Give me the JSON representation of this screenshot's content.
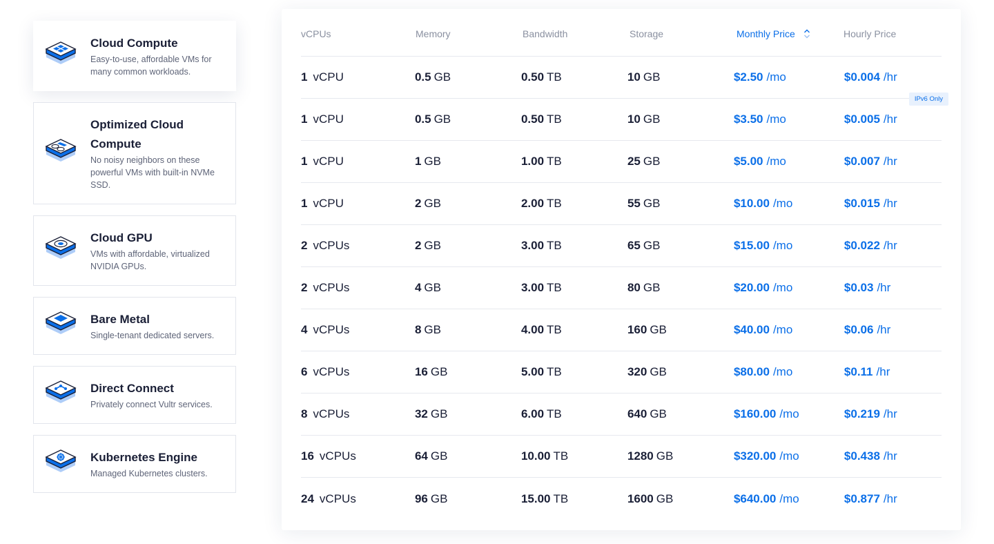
{
  "products": [
    {
      "id": "cloud-compute",
      "title": "Cloud Compute",
      "desc": "Easy-to-use, affordable VMs for many common workloads.",
      "active": true
    },
    {
      "id": "optimized-cloud-compute",
      "title": "Optimized Cloud Compute",
      "desc": "No noisy neighbors on these powerful VMs with built-in NVMe SSD.",
      "active": false
    },
    {
      "id": "cloud-gpu",
      "title": "Cloud GPU",
      "desc": "VMs with affordable, virtualized NVIDIA GPUs.",
      "active": false
    },
    {
      "id": "bare-metal",
      "title": "Bare Metal",
      "desc": "Single-tenant dedicated servers.",
      "active": false
    },
    {
      "id": "direct-connect",
      "title": "Direct Connect",
      "desc": "Privately connect Vultr services.",
      "active": false
    },
    {
      "id": "kubernetes-engine",
      "title": "Kubernetes Engine",
      "desc": "Managed Kubernetes clusters.",
      "active": false
    }
  ],
  "table": {
    "headers": {
      "vcpus": "vCPUs",
      "memory": "Memory",
      "bandwidth": "Bandwidth",
      "storage": "Storage",
      "monthly": "Monthly Price",
      "hourly": "Hourly Price"
    },
    "rows": [
      {
        "vcpu": "1",
        "vcpu_unit": "vCPU",
        "mem": "0.5",
        "mem_unit": "GB",
        "bw": "0.50",
        "bw_unit": "TB",
        "sto": "10",
        "sto_unit": "GB",
        "mo": "$2.50",
        "mo_unit": "/mo",
        "hr": "$0.004",
        "hr_unit": "/hr",
        "badge": "IPv6 Only"
      },
      {
        "vcpu": "1",
        "vcpu_unit": "vCPU",
        "mem": "0.5",
        "mem_unit": "GB",
        "bw": "0.50",
        "bw_unit": "TB",
        "sto": "10",
        "sto_unit": "GB",
        "mo": "$3.50",
        "mo_unit": "/mo",
        "hr": "$0.005",
        "hr_unit": "/hr"
      },
      {
        "vcpu": "1",
        "vcpu_unit": "vCPU",
        "mem": "1",
        "mem_unit": "GB",
        "bw": "1.00",
        "bw_unit": "TB",
        "sto": "25",
        "sto_unit": "GB",
        "mo": "$5.00",
        "mo_unit": "/mo",
        "hr": "$0.007",
        "hr_unit": "/hr"
      },
      {
        "vcpu": "1",
        "vcpu_unit": "vCPU",
        "mem": "2",
        "mem_unit": "GB",
        "bw": "2.00",
        "bw_unit": "TB",
        "sto": "55",
        "sto_unit": "GB",
        "mo": "$10.00",
        "mo_unit": "/mo",
        "hr": "$0.015",
        "hr_unit": "/hr"
      },
      {
        "vcpu": "2",
        "vcpu_unit": "vCPUs",
        "mem": "2",
        "mem_unit": "GB",
        "bw": "3.00",
        "bw_unit": "TB",
        "sto": "65",
        "sto_unit": "GB",
        "mo": "$15.00",
        "mo_unit": "/mo",
        "hr": "$0.022",
        "hr_unit": "/hr"
      },
      {
        "vcpu": "2",
        "vcpu_unit": "vCPUs",
        "mem": "4",
        "mem_unit": "GB",
        "bw": "3.00",
        "bw_unit": "TB",
        "sto": "80",
        "sto_unit": "GB",
        "mo": "$20.00",
        "mo_unit": "/mo",
        "hr": "$0.03",
        "hr_unit": "/hr"
      },
      {
        "vcpu": "4",
        "vcpu_unit": "vCPUs",
        "mem": "8",
        "mem_unit": "GB",
        "bw": "4.00",
        "bw_unit": "TB",
        "sto": "160",
        "sto_unit": "GB",
        "mo": "$40.00",
        "mo_unit": "/mo",
        "hr": "$0.06",
        "hr_unit": "/hr"
      },
      {
        "vcpu": "6",
        "vcpu_unit": "vCPUs",
        "mem": "16",
        "mem_unit": "GB",
        "bw": "5.00",
        "bw_unit": "TB",
        "sto": "320",
        "sto_unit": "GB",
        "mo": "$80.00",
        "mo_unit": "/mo",
        "hr": "$0.11",
        "hr_unit": "/hr"
      },
      {
        "vcpu": "8",
        "vcpu_unit": "vCPUs",
        "mem": "32",
        "mem_unit": "GB",
        "bw": "6.00",
        "bw_unit": "TB",
        "sto": "640",
        "sto_unit": "GB",
        "mo": "$160.00",
        "mo_unit": "/mo",
        "hr": "$0.219",
        "hr_unit": "/hr"
      },
      {
        "vcpu": "16",
        "vcpu_unit": "vCPUs",
        "mem": "64",
        "mem_unit": "GB",
        "bw": "10.00",
        "bw_unit": "TB",
        "sto": "1280",
        "sto_unit": "GB",
        "mo": "$320.00",
        "mo_unit": "/mo",
        "hr": "$0.438",
        "hr_unit": "/hr"
      },
      {
        "vcpu": "24",
        "vcpu_unit": "vCPUs",
        "mem": "96",
        "mem_unit": "GB",
        "bw": "15.00",
        "bw_unit": "TB",
        "sto": "1600",
        "sto_unit": "GB",
        "mo": "$640.00",
        "mo_unit": "/mo",
        "hr": "$0.877",
        "hr_unit": "/hr"
      }
    ]
  },
  "icons": {
    "sort": "sort-up-down-icon",
    "products": [
      "cloud-compute-icon",
      "optimized-cloud-compute-icon",
      "cloud-gpu-icon",
      "bare-metal-icon",
      "direct-connect-icon",
      "kubernetes-icon"
    ]
  },
  "colors": {
    "accent": "#0b6fe8",
    "accent_light": "#7fb1f5",
    "text": "#1a1f36",
    "muted": "#8a90a0"
  }
}
